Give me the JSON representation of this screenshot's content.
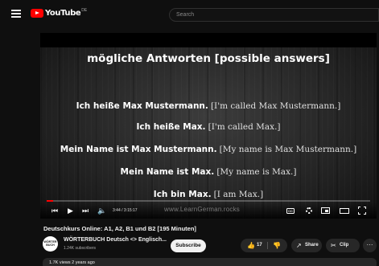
{
  "masthead": {
    "logo_text": "YouTube",
    "logo_country": "DE",
    "search_placeholder": "Search"
  },
  "video_slide": {
    "heading": "mögliche Antworten [possible answers]",
    "lines": [
      {
        "german": "Ich heiße Max Mustermann.",
        "english": "[I'm called Max Mustermann.]"
      },
      {
        "german": "Ich heiße Max.",
        "english": "[I'm called Max.]"
      },
      {
        "german": "Mein Name ist Max Mustermann.",
        "english": "[My name is Max Mustermann.]"
      },
      {
        "german": "Mein Name ist Max.",
        "english": "[My name is Max.]"
      },
      {
        "german": "Ich bin Max.",
        "english": "[I am Max.]"
      }
    ],
    "watermark": "www.LearnGerman.rocks"
  },
  "player": {
    "time": "3:44 / 3:15:17",
    "progress_fraction": 0.019,
    "accent_color": "#ff0000"
  },
  "video": {
    "title": "Deutschkurs Online: A1, A2, B1 und B2 [195 Minuten]",
    "channel_name": "WÖRTERBUCH Deutsch <> Englisch...",
    "channel_avatar_text": "WÖRTER BUCH",
    "subscribers": "1.24K subscribers",
    "subscribe_label": "Subscribe",
    "likes": "17",
    "share_label": "Share",
    "clip_label": "Clip",
    "views": "1.7K views  2 years ago"
  },
  "icons": [
    "menu-icon",
    "play-icon",
    "next-icon",
    "volume-icon",
    "cc-icon",
    "gear-icon",
    "miniplayer-icon",
    "theater-icon",
    "fullscreen-icon",
    "like-icon",
    "dislike-icon",
    "share-icon",
    "clip-icon",
    "more-icon"
  ]
}
